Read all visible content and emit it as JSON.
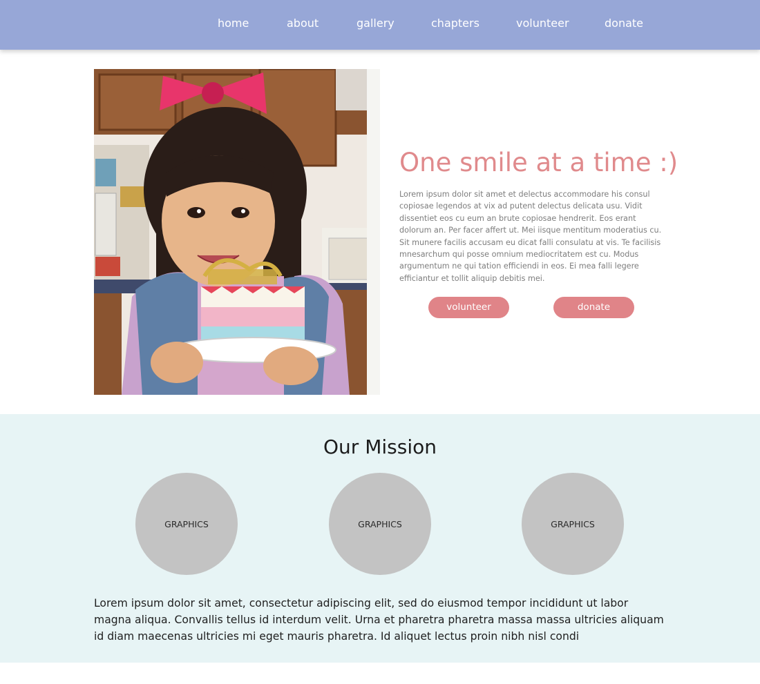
{
  "nav": {
    "items": [
      {
        "label": "home"
      },
      {
        "label": "about"
      },
      {
        "label": "gallery"
      },
      {
        "label": "chapters"
      },
      {
        "label": "volunteer"
      },
      {
        "label": "donate"
      }
    ]
  },
  "hero": {
    "photo_icon": "birthday-girl-photo",
    "title": "One smile at a time :)",
    "body": "Lorem ipsum dolor sit amet et delectus accommodare his consul copiosae legendos at vix ad putent delectus delicata usu. Vidit dissentiet eos cu eum an brute copiosae hendrerit. Eos erant dolorum an. Per facer affert ut. Mei iisque mentitum moderatius cu. Sit munere facilis accusam eu dicat falli consulatu at vis. Te facilisis mnesarchum qui posse omnium mediocritatem est cu. Modus argumentum ne qui tation efficiendi in eos. Ei mea falli legere efficiantur et tollit aliquip debitis mei.",
    "volunteer_label": "volunteer",
    "donate_label": "donate"
  },
  "mission": {
    "title": "Our Mission",
    "graphics": [
      {
        "label": "GRAPHICS"
      },
      {
        "label": "GRAPHICS"
      },
      {
        "label": "GRAPHICS"
      }
    ],
    "body": "Lorem ipsum dolor sit amet, consectetur adipiscing elit, sed do eiusmod tempor incididunt ut labor magna aliqua. Convallis tellus id interdum velit. Urna et pharetra pharetra massa massa ultricies  aliquam id diam maecenas ultricies mi eget mauris pharetra. Id aliquet lectus proin nibh nisl condi"
  },
  "colors": {
    "nav_bg": "#97a7d7",
    "accent": "#e08488",
    "mission_bg": "#e7f4f5",
    "graphic_circle": "#c3c3c3"
  }
}
